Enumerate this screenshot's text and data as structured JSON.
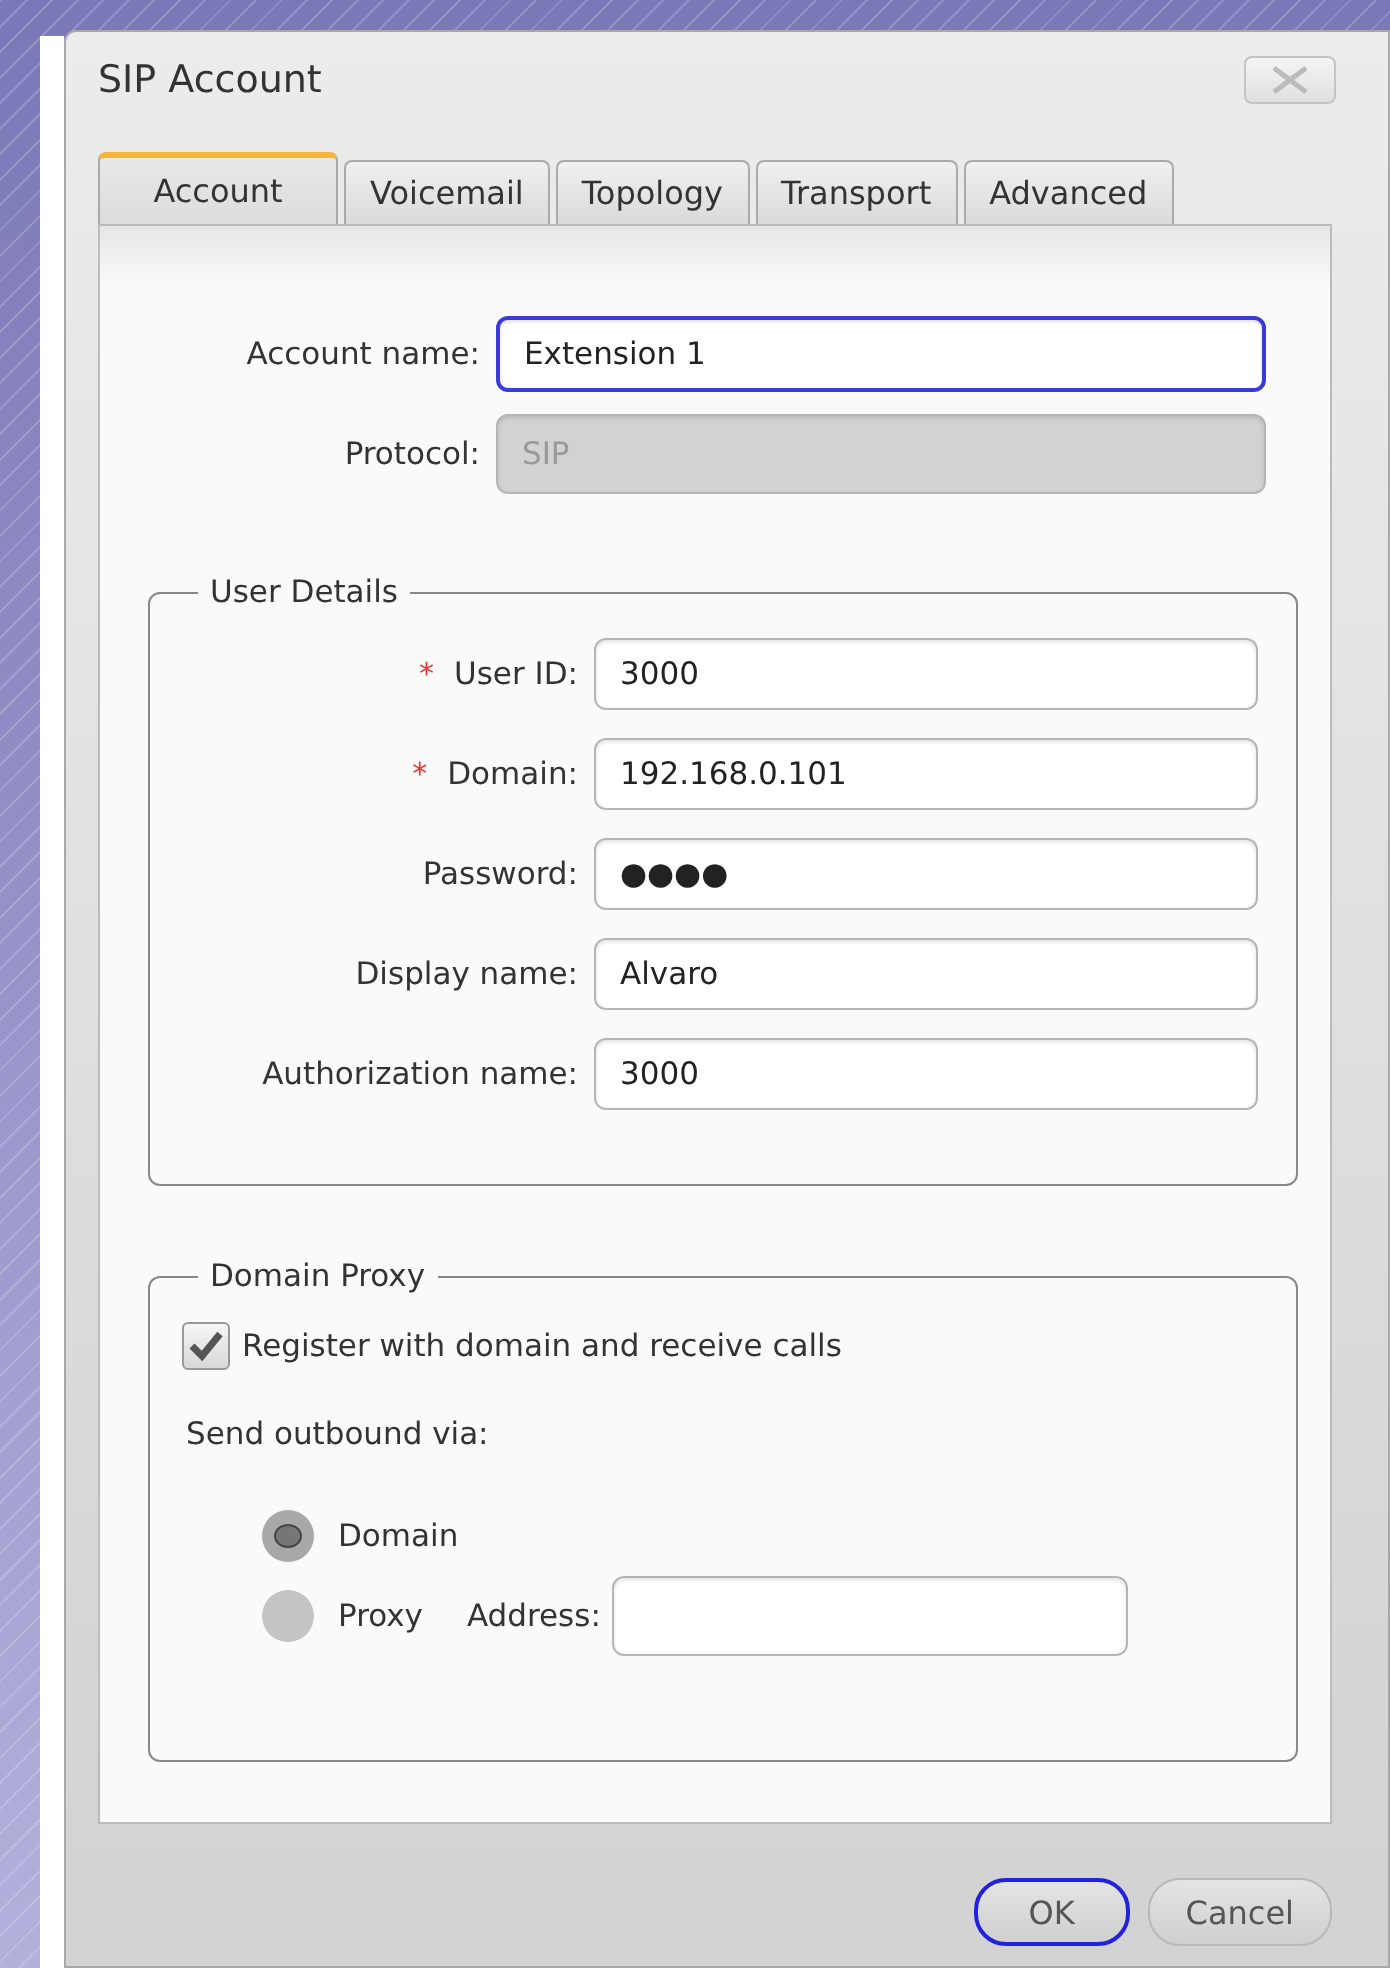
{
  "window": {
    "title": "SIP Account"
  },
  "tabs": [
    {
      "label": "Account",
      "selected": true
    },
    {
      "label": "Voicemail",
      "selected": false
    },
    {
      "label": "Topology",
      "selected": false
    },
    {
      "label": "Transport",
      "selected": false
    },
    {
      "label": "Advanced",
      "selected": false
    }
  ],
  "account": {
    "fields": [
      {
        "label": "Account name:",
        "value": "Extension 1",
        "focused": true,
        "disabled": false
      },
      {
        "label": "Protocol:",
        "value": "SIP",
        "focused": false,
        "disabled": true
      }
    ]
  },
  "user_details": {
    "title": "User Details",
    "fields": [
      {
        "label": "User ID:",
        "value": "3000",
        "required_mark": "*"
      },
      {
        "label": "Domain:",
        "value": "192.168.0.101",
        "required_mark": "*"
      },
      {
        "label": "Password:",
        "value": "●●●●"
      },
      {
        "label": "Display name:",
        "value": "Alvaro"
      },
      {
        "label": "Authorization name:",
        "value": "3000"
      }
    ]
  },
  "domain_proxy": {
    "title": "Domain Proxy",
    "register": {
      "label": "Register with domain and receive calls",
      "checked": true
    },
    "send_label": "Send outbound via:",
    "options": [
      {
        "label": "Domain",
        "selected": true
      },
      {
        "label": "Proxy",
        "selected": false
      }
    ],
    "address": {
      "label": "Address:"
    }
  },
  "buttons": [
    {
      "label": "OK",
      "default": true
    },
    {
      "label": "Cancel",
      "default": false
    }
  ]
}
